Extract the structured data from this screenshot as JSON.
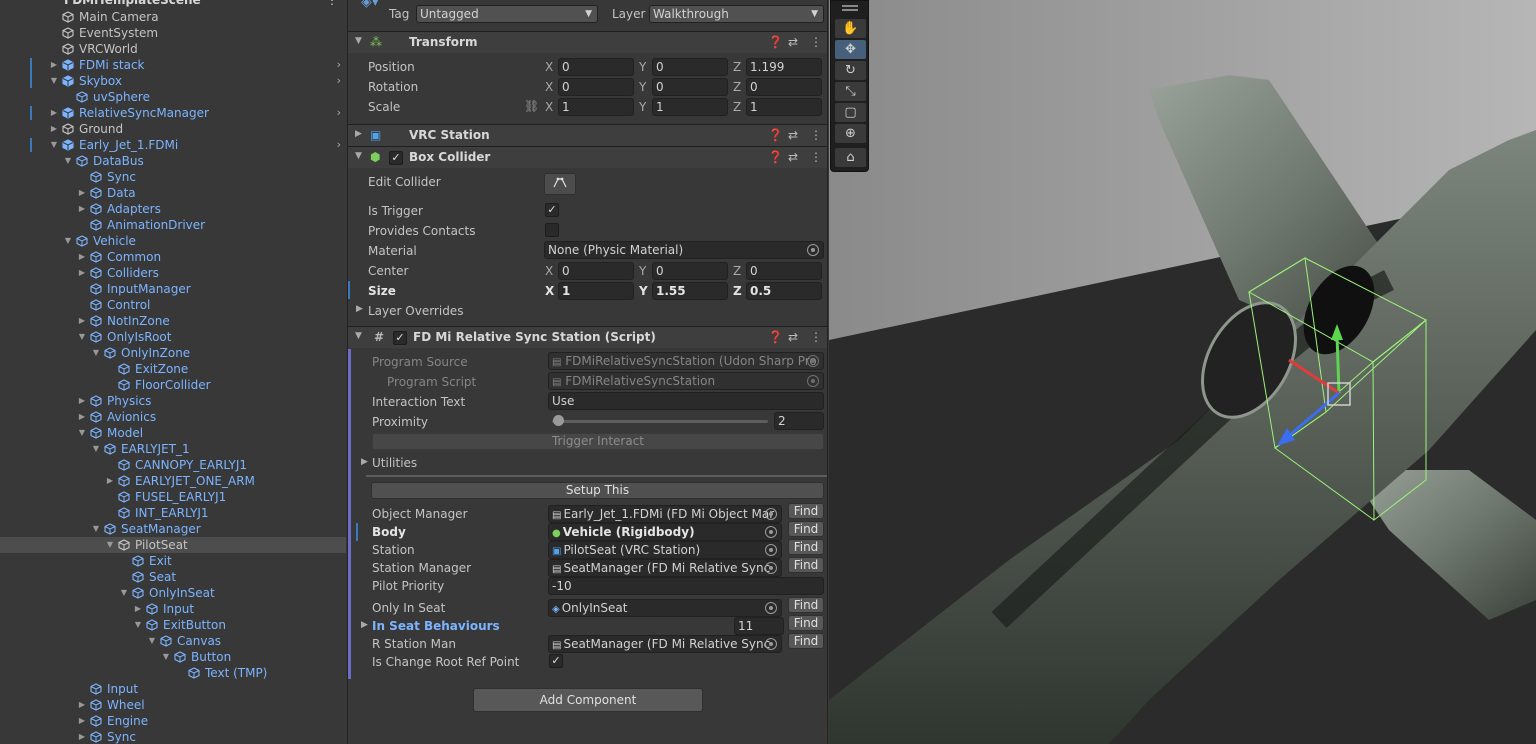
{
  "hierarchy": {
    "partial_top_label": "FDMiTemplateScene",
    "items": [
      {
        "label": "Main Camera",
        "depth": 0,
        "fold": "none",
        "prefab": false,
        "chev": false
      },
      {
        "label": "EventSystem",
        "depth": 0,
        "fold": "none",
        "prefab": false,
        "chev": false
      },
      {
        "label": "VRCWorld",
        "depth": 0,
        "fold": "none",
        "prefab": false,
        "chev": false
      },
      {
        "label": "FDMi stack",
        "depth": 0,
        "fold": "closed",
        "prefab": true,
        "chev": true
      },
      {
        "label": "Skybox",
        "depth": 0,
        "fold": "open",
        "prefab": true,
        "chev": true
      },
      {
        "label": "uvSphere",
        "depth": 1,
        "fold": "none",
        "prefab": true,
        "chev": false
      },
      {
        "label": "RelativeSyncManager",
        "depth": 0,
        "fold": "closed",
        "prefab": true,
        "chev": true
      },
      {
        "label": "Ground",
        "depth": 0,
        "fold": "closed",
        "prefab": false,
        "chev": false
      },
      {
        "label": "Early_Jet_1.FDMi",
        "depth": 0,
        "fold": "open",
        "prefab": true,
        "chev": true
      },
      {
        "label": "DataBus",
        "depth": 1,
        "fold": "open",
        "prefab": true,
        "chev": false
      },
      {
        "label": "Sync",
        "depth": 2,
        "fold": "none",
        "prefab": true,
        "chev": false
      },
      {
        "label": "Data",
        "depth": 2,
        "fold": "closed",
        "prefab": true,
        "chev": false
      },
      {
        "label": "Adapters",
        "depth": 2,
        "fold": "closed",
        "prefab": true,
        "chev": false
      },
      {
        "label": "AnimationDriver",
        "depth": 2,
        "fold": "none",
        "prefab": true,
        "chev": false
      },
      {
        "label": "Vehicle",
        "depth": 1,
        "fold": "open",
        "prefab": true,
        "chev": false
      },
      {
        "label": "Common",
        "depth": 2,
        "fold": "closed",
        "prefab": true,
        "chev": false
      },
      {
        "label": "Colliders",
        "depth": 2,
        "fold": "closed",
        "prefab": true,
        "chev": false
      },
      {
        "label": "InputManager",
        "depth": 2,
        "fold": "none",
        "prefab": true,
        "chev": false
      },
      {
        "label": "Control",
        "depth": 2,
        "fold": "none",
        "prefab": true,
        "chev": false
      },
      {
        "label": "NotInZone",
        "depth": 2,
        "fold": "closed",
        "prefab": true,
        "chev": false
      },
      {
        "label": "OnlyIsRoot",
        "depth": 2,
        "fold": "open",
        "prefab": true,
        "chev": false
      },
      {
        "label": "OnlyInZone",
        "depth": 3,
        "fold": "open",
        "prefab": true,
        "chev": false
      },
      {
        "label": "ExitZone",
        "depth": 4,
        "fold": "none",
        "prefab": true,
        "chev": false
      },
      {
        "label": "FloorCollider",
        "depth": 4,
        "fold": "none",
        "prefab": true,
        "chev": false
      },
      {
        "label": "Physics",
        "depth": 2,
        "fold": "closed",
        "prefab": true,
        "chev": false
      },
      {
        "label": "Avionics",
        "depth": 2,
        "fold": "closed",
        "prefab": true,
        "chev": false
      },
      {
        "label": "Model",
        "depth": 2,
        "fold": "open",
        "prefab": true,
        "chev": false
      },
      {
        "label": "EARLYJET_1",
        "depth": 3,
        "fold": "open",
        "prefab": true,
        "chev": false
      },
      {
        "label": "CANNOPY_EARLYJ1",
        "depth": 4,
        "fold": "none",
        "prefab": true,
        "chev": false
      },
      {
        "label": "EARLYJET_ONE_ARM",
        "depth": 4,
        "fold": "closed",
        "prefab": true,
        "chev": false
      },
      {
        "label": "FUSEL_EARLYJ1",
        "depth": 4,
        "fold": "none",
        "prefab": true,
        "chev": false
      },
      {
        "label": "INT_EARLYJ1",
        "depth": 4,
        "fold": "none",
        "prefab": true,
        "chev": false
      },
      {
        "label": "SeatManager",
        "depth": 3,
        "fold": "open",
        "prefab": true,
        "chev": false
      },
      {
        "label": "PilotSeat",
        "depth": 4,
        "fold": "open",
        "prefab": false,
        "chev": false,
        "selected": true
      },
      {
        "label": "Exit",
        "depth": 5,
        "fold": "none",
        "prefab": true,
        "chev": false
      },
      {
        "label": "Seat",
        "depth": 5,
        "fold": "none",
        "prefab": true,
        "chev": false
      },
      {
        "label": "OnlyInSeat",
        "depth": 5,
        "fold": "open",
        "prefab": true,
        "chev": false
      },
      {
        "label": "Input",
        "depth": 6,
        "fold": "closed",
        "prefab": true,
        "chev": false
      },
      {
        "label": "ExitButton",
        "depth": 6,
        "fold": "open",
        "prefab": true,
        "chev": false
      },
      {
        "label": "Canvas",
        "depth": 7,
        "fold": "open",
        "prefab": true,
        "chev": false
      },
      {
        "label": "Button",
        "depth": 8,
        "fold": "open",
        "prefab": true,
        "chev": false
      },
      {
        "label": "Text (TMP)",
        "depth": 9,
        "fold": "none",
        "prefab": true,
        "chev": false
      },
      {
        "label": "Input",
        "depth": 2,
        "fold": "none",
        "prefab": true,
        "chev": false
      },
      {
        "label": "Wheel",
        "depth": 2,
        "fold": "closed",
        "prefab": true,
        "chev": false
      },
      {
        "label": "Engine",
        "depth": 2,
        "fold": "closed",
        "prefab": true,
        "chev": false
      },
      {
        "label": "Sync",
        "depth": 2,
        "fold": "closed",
        "prefab": true,
        "chev": false
      }
    ]
  },
  "inspector": {
    "tag_label": "Tag",
    "tag_value": "Untagged",
    "layer_label": "Layer",
    "layer_value": "Walkthrough",
    "transform": {
      "title": "Transform",
      "position_label": "Position",
      "rotation_label": "Rotation",
      "scale_label": "Scale",
      "x": "X",
      "y": "Y",
      "z": "Z",
      "position": [
        "0",
        "0",
        "1.199"
      ],
      "rotation": [
        "0",
        "0",
        "0"
      ],
      "scale": [
        "1",
        "1",
        "1"
      ]
    },
    "vrc_station": {
      "title": "VRC Station"
    },
    "box_collider": {
      "title": "Box Collider",
      "edit_collider": "Edit Collider",
      "is_trigger": "Is Trigger",
      "provides_contacts": "Provides Contacts",
      "material_label": "Material",
      "material_value": "None (Physic Material)",
      "center_label": "Center",
      "center": [
        "0",
        "0",
        "0"
      ],
      "size_label": "Size",
      "size": [
        "1",
        "1.55",
        "0.5"
      ],
      "layer_overrides": "Layer Overrides"
    },
    "script": {
      "title": "FD Mi Relative Sync Station (Script)",
      "program_source_label": "Program Source",
      "program_source_value": "FDMiRelativeSyncStation (Udon Sharp Pro",
      "program_script_label": "Program Script",
      "program_script_value": "FDMiRelativeSyncStation",
      "interaction_text_label": "Interaction Text",
      "interaction_text_value": "Use",
      "proximity_label": "Proximity",
      "proximity_value": "2",
      "proximity_fraction": 0,
      "trigger_interact": "Trigger Interact",
      "utilities": "Utilities",
      "setup_this": "Setup This",
      "find": "Find",
      "object_manager_label": "Object Manager",
      "object_manager_value": "Early_Jet_1.FDMi (FD Mi Object Mar",
      "body_label": "Body",
      "body_value": "Vehicle (Rigidbody)",
      "station_label": "Station",
      "station_value": "PilotSeat (VRC Station)",
      "station_manager_label": "Station Manager",
      "station_manager_value": "SeatManager (FD Mi Relative Sync",
      "pilot_priority_label": "Pilot Priority",
      "pilot_priority_value": "-10",
      "only_in_seat_label": "Only In Seat",
      "only_in_seat_value": "OnlyInSeat",
      "in_seat_behaviours_label": "In Seat Behaviours",
      "in_seat_behaviours_value": "11",
      "r_station_man_label": "R Station Man",
      "r_station_man_value": "SeatManager (FD Mi Relative Sync",
      "is_change_root_label": "Is Change Root Ref Point"
    },
    "add_component": "Add Component"
  },
  "colors": {
    "prefab_blue": "#7cb4ff",
    "selection": "#4d4d4d",
    "panel": "#383838",
    "header": "#3e3e3e",
    "gizmo_green": "#9cf27a",
    "axis_red": "#e33b3b",
    "axis_green": "#5cd64e",
    "axis_blue": "#3a6df0"
  },
  "scene_tools": [
    "hand-icon",
    "move-icon",
    "rotate-icon",
    "scale-icon",
    "rect-icon",
    "transform-icon",
    "custom-tool-icon"
  ]
}
